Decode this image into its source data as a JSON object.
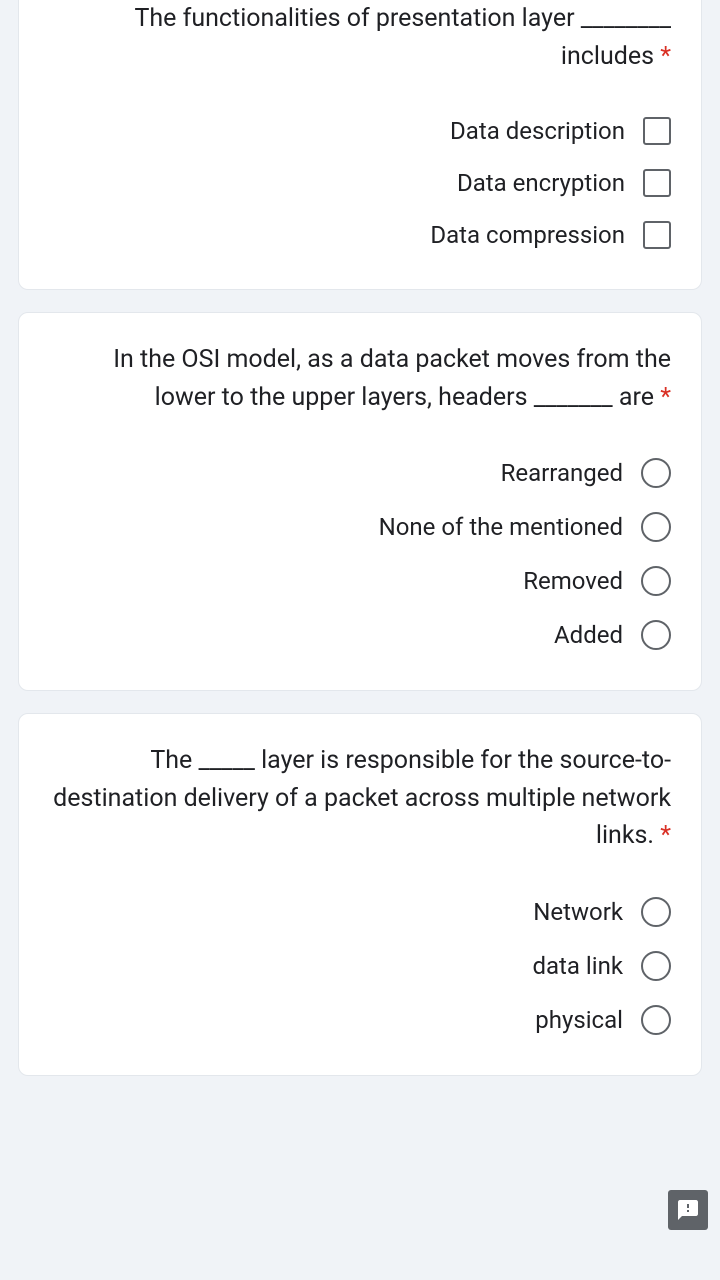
{
  "questions": [
    {
      "text_pre": "The functionalities of presentation layer ",
      "blank": "________",
      "text_post": " includes",
      "type": "checkbox",
      "options": [
        "Data description",
        "Data encryption",
        "Data compression"
      ]
    },
    {
      "text_pre": "In the OSI model, as a data packet moves from the lower to the upper layers, headers ",
      "blank": "_______",
      "text_post": " are",
      "type": "radio",
      "options": [
        "Rearranged",
        "None of the mentioned",
        "Removed",
        "Added"
      ]
    },
    {
      "text_pre": "The ",
      "blank": "_____",
      "text_post": " layer is responsible for the source-to-destination delivery of a packet across multiple network links.",
      "type": "radio",
      "options": [
        "Network",
        "data link",
        "physical"
      ]
    }
  ],
  "asterisk": "*",
  "report_label": "report-problem"
}
